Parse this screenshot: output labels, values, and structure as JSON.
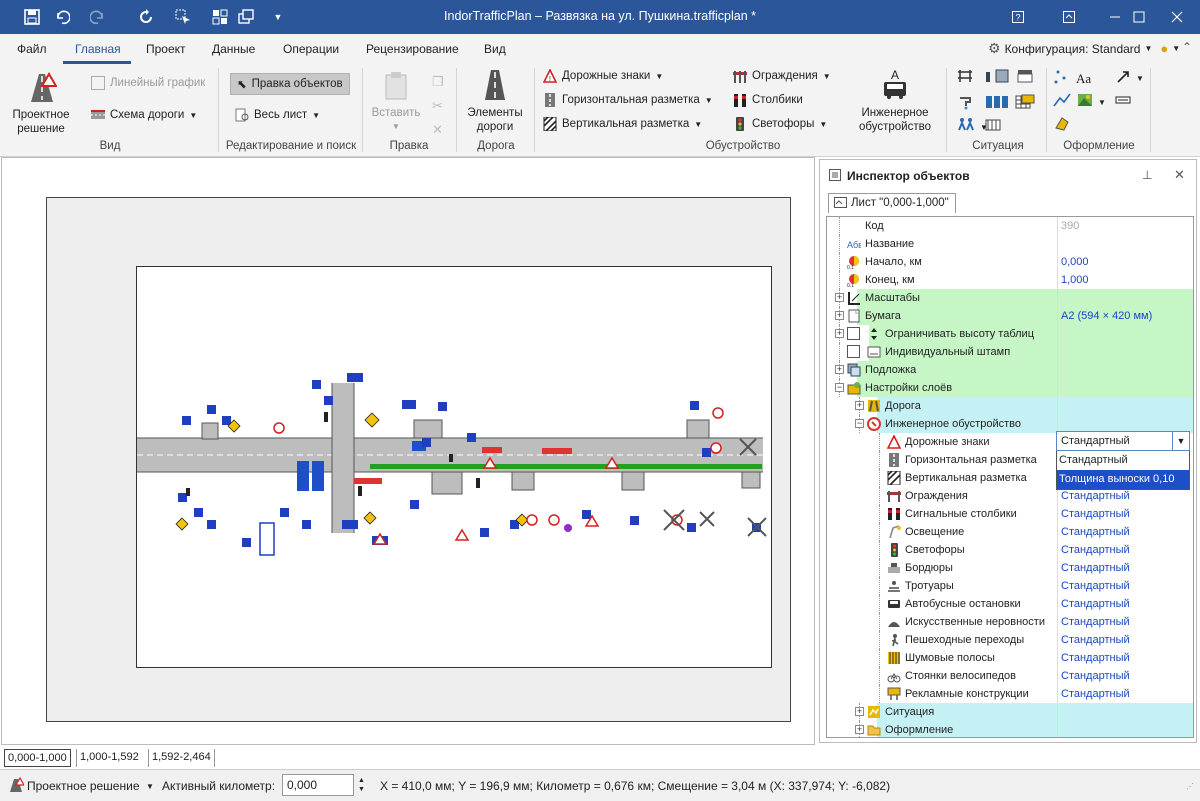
{
  "app": {
    "title": "IndorTrafficPlan – Развязка на ул. Пушкина.trafficplan *"
  },
  "menu": {
    "items": [
      "Файл",
      "Главная",
      "Проект",
      "Данные",
      "Операции",
      "Рецензирование",
      "Вид"
    ],
    "active": "Главная",
    "config_label": "Конфигурация: Standard"
  },
  "ribbon": {
    "project_solution": "Проектное\nрешение",
    "line_chart": "Линейный график",
    "road_scheme": "Схема дороги",
    "edit_objects": "Правка объектов",
    "whole_sheet": "Весь лист",
    "insert": "Вставить",
    "road_elements": "Элементы\nдороги",
    "road_signs": "Дорожные знаки",
    "horiz_marking": "Горизонтальная разметка",
    "vert_marking": "Вертикальная разметка",
    "fences": "Ограждения",
    "posts": "Столбики",
    "traffic_lights": "Светофоры",
    "engineering": "Инженерное\nобустройство",
    "groups": {
      "view": "Вид",
      "edit_search": "Редактирование и поиск",
      "edit": "Правка",
      "road": "Дорога",
      "equipment": "Обустройство",
      "situation": "Ситуация",
      "design": "Оформление"
    }
  },
  "inspector": {
    "title": "Инспектор объектов",
    "tab": "Лист \"0,000-1,000\"",
    "rows": [
      {
        "name": "Код",
        "value": "390"
      },
      {
        "name": "Название",
        "value": ""
      },
      {
        "name": "Начало, км",
        "value": "0,000"
      },
      {
        "name": "Конец, км",
        "value": "1,000"
      },
      {
        "name": "Масштабы",
        "value": ""
      },
      {
        "name": "Бумага",
        "value": "A2 (594 × 420 мм)"
      },
      {
        "name": "Ограничивать высоту таблиц",
        "value": ""
      },
      {
        "name": "Индивидуальный штамп",
        "value": ""
      },
      {
        "name": "Подложка",
        "value": ""
      },
      {
        "name": "Настройки слоёв",
        "value": ""
      },
      {
        "name": "Дорога",
        "value": ""
      },
      {
        "name": "Инженерное обустройство",
        "value": ""
      },
      {
        "name": "Дорожные знаки",
        "value": "Стандартный"
      },
      {
        "name": "Горизонтальная разметка",
        "value": ""
      },
      {
        "name": "Вертикальная разметка",
        "value": ""
      },
      {
        "name": "Ограждения",
        "value": "Стандартный"
      },
      {
        "name": "Сигнальные столбики",
        "value": "Стандартный"
      },
      {
        "name": "Освещение",
        "value": "Стандартный"
      },
      {
        "name": "Светофоры",
        "value": "Стандартный"
      },
      {
        "name": "Бордюры",
        "value": "Стандартный"
      },
      {
        "name": "Тротуары",
        "value": "Стандартный"
      },
      {
        "name": "Автобусные остановки",
        "value": "Стандартный"
      },
      {
        "name": "Искусственные неровности",
        "value": "Стандартный"
      },
      {
        "name": "Пешеходные переходы",
        "value": "Стандартный"
      },
      {
        "name": "Шумовые полосы",
        "value": "Стандартный"
      },
      {
        "name": "Стоянки велосипедов",
        "value": "Стандартный"
      },
      {
        "name": "Рекламные конструкции",
        "value": "Стандартный"
      },
      {
        "name": "Ситуация",
        "value": ""
      },
      {
        "name": "Оформление",
        "value": ""
      }
    ],
    "dropdown": {
      "selected": "Стандартный",
      "options": [
        "Стандартный",
        "Толщина выноски 0,10"
      ],
      "highlighted": "Толщина выноски 0,10"
    }
  },
  "sheet_tabs": [
    "0,000-1,000",
    "1,000-1,592",
    "1,592-2,464"
  ],
  "status": {
    "mode": "Проектное решение",
    "active_km_label": "Активный километр:",
    "active_km_value": "0,000",
    "coords": "X = 410,0 мм; Y = 196,9 мм; Километр = 0,676 км; Смещение = 3,04 м (X: 337,974; Y: -6,082)"
  },
  "colors": {
    "titlebar": "#2b579a",
    "green_row": "#c6f5c6",
    "cyan_row": "#c5f1f5",
    "value_text": "#1a47c0"
  }
}
